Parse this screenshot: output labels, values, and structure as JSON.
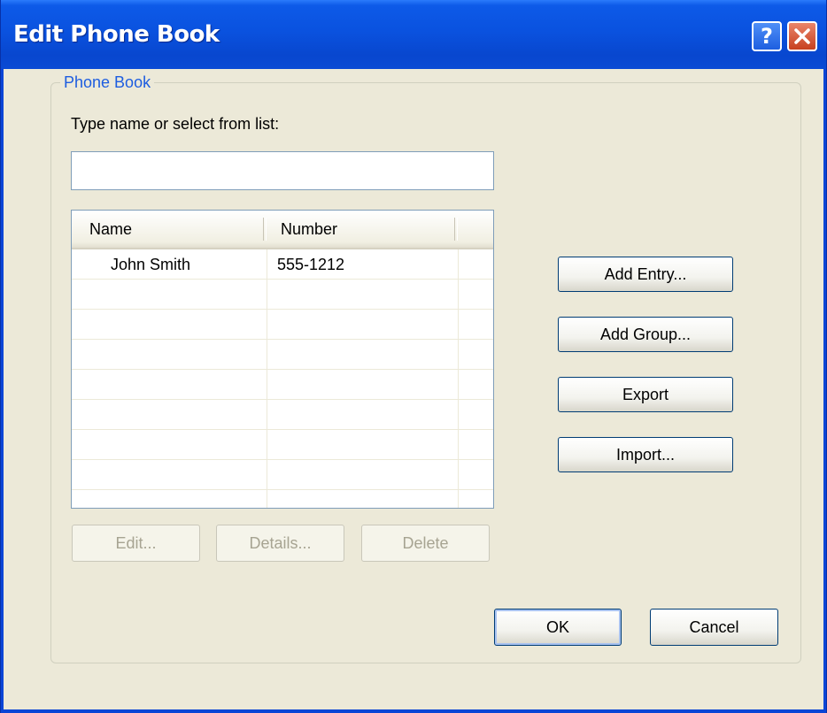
{
  "window": {
    "title": "Edit Phone Book",
    "help_glyph": "?",
    "icons": [
      "help-icon",
      "close-icon"
    ],
    "colors": {
      "titlebar": "#0a52df",
      "face": "#ece9d8",
      "group_label": "#1d5de0",
      "close": "#c7401f"
    }
  },
  "phonebook": {
    "group_label": "Phone Book",
    "prompt": "Type name or select from list:",
    "search": {
      "value": "",
      "placeholder": ""
    },
    "columns": [
      "Name",
      "Number",
      ""
    ],
    "rows": [
      {
        "name": "John Smith",
        "number": "555-1212"
      },
      {
        "name": "",
        "number": ""
      },
      {
        "name": "",
        "number": ""
      },
      {
        "name": "",
        "number": ""
      },
      {
        "name": "",
        "number": ""
      },
      {
        "name": "",
        "number": ""
      },
      {
        "name": "",
        "number": ""
      },
      {
        "name": "",
        "number": ""
      }
    ],
    "row_buttons": {
      "edit": "Edit...",
      "details": "Details...",
      "delete": "Delete"
    }
  },
  "side_buttons": {
    "add_entry": "Add Entry...",
    "add_group": "Add Group...",
    "export": "Export",
    "import": "Import..."
  },
  "footer": {
    "ok": "OK",
    "cancel": "Cancel"
  }
}
